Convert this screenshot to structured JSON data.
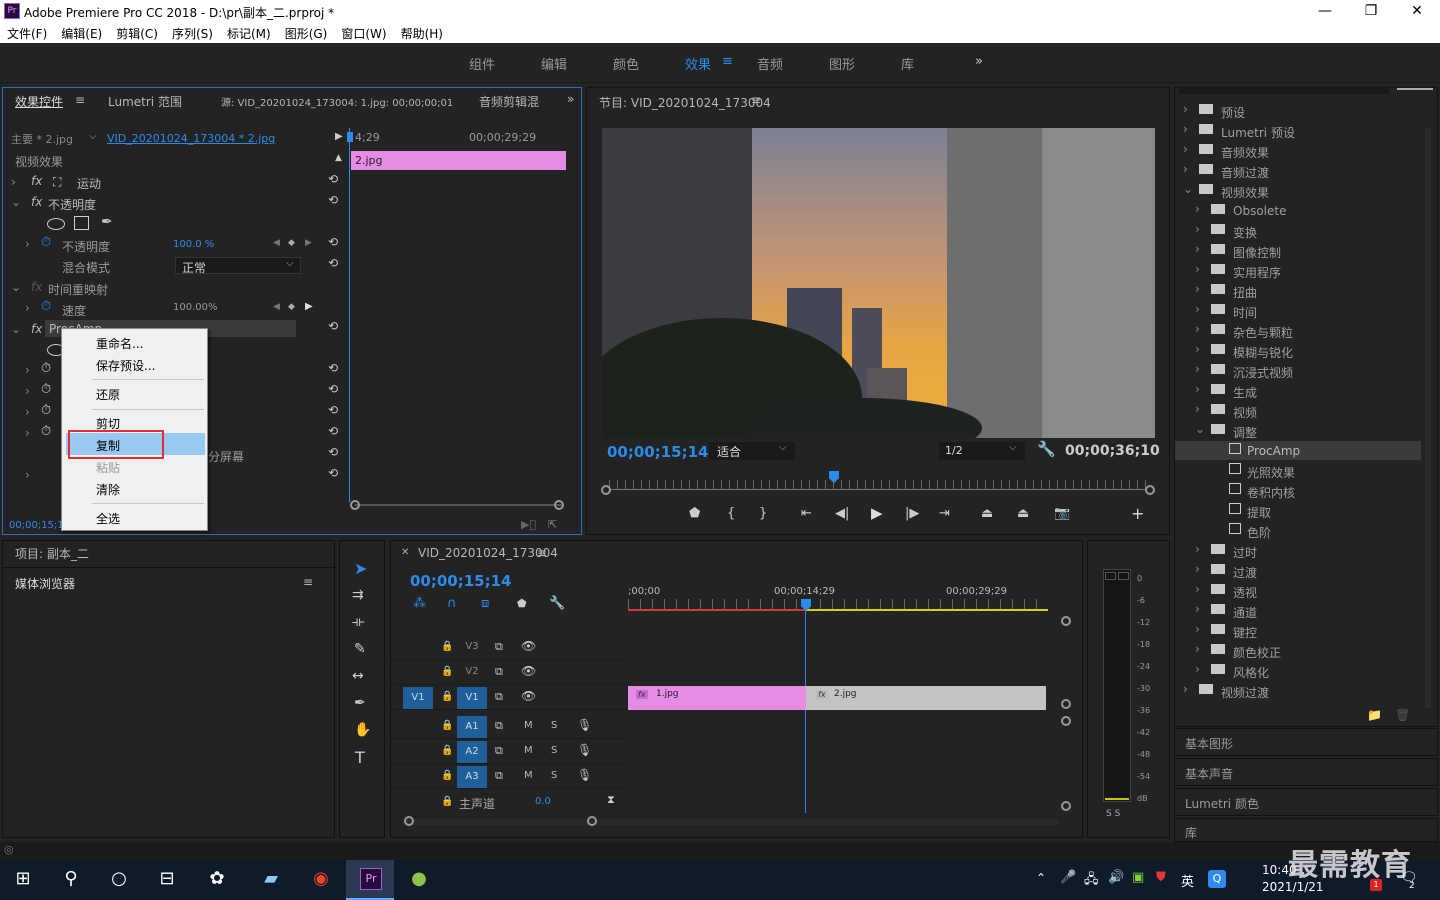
{
  "app": {
    "title": "Adobe Premiere Pro CC 2018 - D:\\pr\\副本_二.prproj *",
    "logo": "Pr"
  },
  "window_controls": {
    "minimize": "—",
    "maximize": "❐",
    "close": "✕"
  },
  "menu": [
    "文件(F)",
    "编辑(E)",
    "剪辑(C)",
    "序列(S)",
    "标记(M)",
    "图形(G)",
    "窗口(W)",
    "帮助(H)"
  ],
  "workspaces": [
    "组件",
    "编辑",
    "颜色",
    "效果",
    "音频",
    "图形",
    "库"
  ],
  "workspace_active": "效果",
  "workspace_more": "»",
  "effect_controls": {
    "tabs": [
      "效果控件",
      "Lumetri 范围",
      "源: VID_20201024_173004: 1.jpg: 00;00;00;01",
      "音频剪辑混"
    ],
    "master": "主要 * 2.jpg",
    "clip": "VID_20201024_173004 * 2.jpg",
    "section": "视频效果",
    "motion": "运动",
    "opacity": "不透明度",
    "opacity_param": "不透明度",
    "opacity_value": "100.0 %",
    "blend_label": "混合模式",
    "blend_value": "正常",
    "time_remap": "时间重映射",
    "speed": "速度",
    "speed_value": "100.00%",
    "procamp": "ProcAmp",
    "split_screen": "分屏幕",
    "ruler_start": "4;29",
    "ruler_end": "00;00;29;29",
    "clip_label": "2.jpg",
    "time": "00;00;15;14"
  },
  "context_menu": {
    "items": [
      "重命名...",
      "保存预设...",
      "还原",
      "剪切",
      "复制",
      "粘贴",
      "清除",
      "全选"
    ],
    "highlighted": "复制",
    "disabled": "粘贴"
  },
  "program": {
    "title": "节目: VID_20201024_173004",
    "timecode": "00;00;15;14",
    "fit": "适合",
    "quality": "1/2",
    "duration": "00;00;36;10"
  },
  "effects_tree": {
    "top": [
      "预设",
      "Lumetri 预设",
      "音频效果",
      "音频过渡",
      "视频效果"
    ],
    "video_effects": [
      "Obsolete",
      "变换",
      "图像控制",
      "实用程序",
      "扭曲",
      "时间",
      "杂色与颗粒",
      "模糊与锐化",
      "沉浸式视频",
      "生成",
      "视频",
      "调整"
    ],
    "adjust": [
      "ProcAmp",
      "光照效果",
      "卷积内核",
      "提取",
      "色阶"
    ],
    "after": [
      "过时",
      "过渡",
      "透视",
      "通道",
      "键控",
      "颜色校正",
      "风格化"
    ],
    "last": "视频过渡",
    "selected": "ProcAmp",
    "panels": [
      "基本图形",
      "基本声音",
      "Lumetri 颜色",
      "库"
    ]
  },
  "project": {
    "title": "项目: 副本_二",
    "media_browser": "媒体浏览器"
  },
  "timeline": {
    "title": "VID_20201024_173004",
    "timecode": "00;00;15;14",
    "ruler": [
      ";00;00",
      "00;00;14;29",
      "00;00;29;29"
    ],
    "tracks_video": [
      "V3",
      "V2",
      "V1"
    ],
    "tracks_audio": [
      "A1",
      "A2",
      "A3"
    ],
    "source_v": "V1",
    "master": "主声道",
    "master_value": "0.0",
    "clip1": "1.jpg",
    "clip2": "2.jpg",
    "audio_m": "M",
    "audio_s": "S"
  },
  "meter": {
    "labels": [
      "0",
      "-6",
      "-12",
      "-18",
      "-24",
      "-30",
      "-36",
      "-42",
      "-48",
      "-54",
      "dB"
    ],
    "solo": "S S"
  },
  "taskbar": {
    "time": "10:40",
    "date": "2021/1/21",
    "lang": "英",
    "watermark": "最需教育",
    "badge": "1",
    "notif": "2"
  }
}
